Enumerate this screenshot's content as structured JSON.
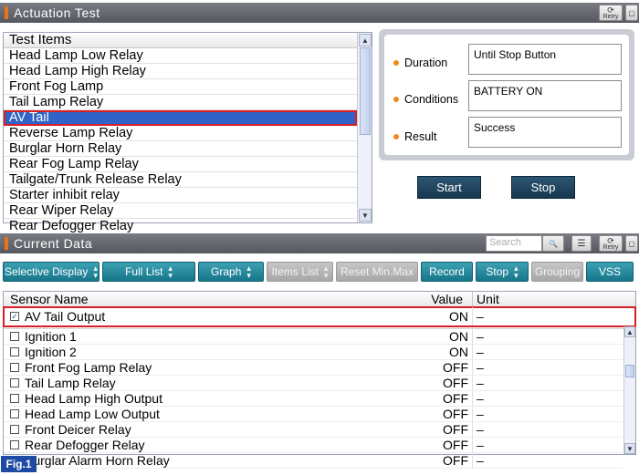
{
  "actuation": {
    "title": "Actuation Test",
    "retry_label": "Retry",
    "list_header": "Test Items",
    "items": [
      {
        "label": "Head Lamp Low Relay",
        "selected": false
      },
      {
        "label": "Head Lamp High Relay",
        "selected": false
      },
      {
        "label": "Front Fog Lamp",
        "selected": false
      },
      {
        "label": "Tail Lamp Relay",
        "selected": false
      },
      {
        "label": "AV Tail",
        "selected": true
      },
      {
        "label": "Reverse Lamp Relay",
        "selected": false
      },
      {
        "label": "Burglar Horn Relay",
        "selected": false
      },
      {
        "label": "Rear Fog Lamp Relay",
        "selected": false
      },
      {
        "label": "Tailgate/Trunk Release Relay",
        "selected": false
      },
      {
        "label": "Starter inhibit relay",
        "selected": false
      },
      {
        "label": "Rear Wiper Relay",
        "selected": false
      },
      {
        "label": "Rear Defogger Relay",
        "selected": false
      }
    ],
    "fields": {
      "duration_label": "Duration",
      "duration_value": "Until Stop Button",
      "conditions_label": "Conditions",
      "conditions_value": "BATTERY ON",
      "result_label": "Result",
      "result_value": "Success"
    },
    "start_label": "Start",
    "stop_label": "Stop"
  },
  "current_data": {
    "title": "Current Data",
    "search_placeholder": "Search",
    "retry_label": "Retry",
    "toolbar": {
      "selective_display": "Selective Display",
      "full_list": "Full List",
      "graph": "Graph",
      "items_list": "Items List",
      "reset_min_max": "Reset Min.Max",
      "record": "Record",
      "stop": "Stop",
      "grouping": "Grouping",
      "vss": "VSS"
    },
    "columns": {
      "sensor_name": "Sensor Name",
      "value": "Value",
      "unit": "Unit"
    },
    "pinned_row": {
      "name": "AV Tail Output",
      "value": "ON",
      "unit": "–",
      "checked": true
    },
    "rows": [
      {
        "name": "Ignition 1",
        "value": "ON",
        "unit": "–"
      },
      {
        "name": "Ignition 2",
        "value": "ON",
        "unit": "–"
      },
      {
        "name": "Front Fog Lamp Relay",
        "value": "OFF",
        "unit": "–"
      },
      {
        "name": "Tail Lamp Relay",
        "value": "OFF",
        "unit": "–"
      },
      {
        "name": "Head Lamp High Output",
        "value": "OFF",
        "unit": "–"
      },
      {
        "name": "Head Lamp Low Output",
        "value": "OFF",
        "unit": "–"
      },
      {
        "name": "Front Deicer Relay",
        "value": "OFF",
        "unit": "–"
      },
      {
        "name": "Rear Defogger Relay",
        "value": "OFF",
        "unit": "–"
      },
      {
        "name": "Burglar Alarm Horn Relay",
        "value": "OFF",
        "unit": "–"
      }
    ]
  },
  "figure_label": "Fig.1",
  "colors": {
    "selection": "#2f63c8",
    "highlight_border": "#d61f26",
    "accent_dot": "#f08a1c",
    "toolbar_teal": "#16778b",
    "dark_button": "#17384f"
  }
}
